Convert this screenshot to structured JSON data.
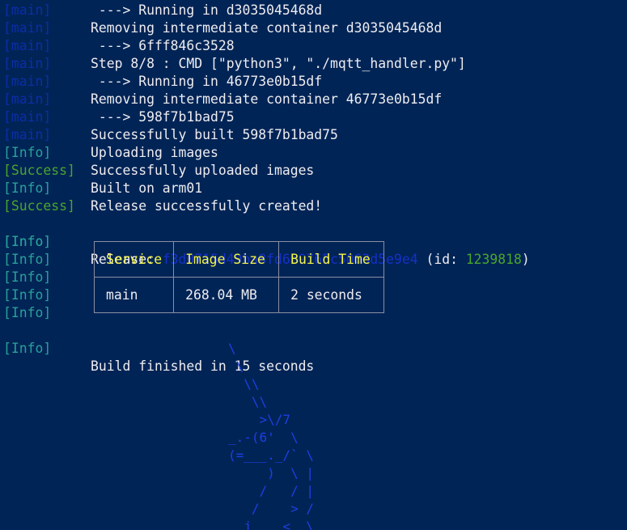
{
  "lines": [
    {
      "tag": "[main]",
      "tag_color": "main",
      "message": " ---> Running in d3035045468d"
    },
    {
      "tag": "[main]",
      "tag_color": "main",
      "message": "Removing intermediate container d3035045468d"
    },
    {
      "tag": "[main]",
      "tag_color": "main",
      "message": " ---> 6fff846c3528"
    },
    {
      "tag": "[main]",
      "tag_color": "main",
      "message": "Step 8/8 : CMD [\"python3\", \"./mqtt_handler.py\"]"
    },
    {
      "tag": "[main]",
      "tag_color": "main",
      "message": " ---> Running in 46773e0b15df"
    },
    {
      "tag": "[main]",
      "tag_color": "main",
      "message": "Removing intermediate container 46773e0b15df"
    },
    {
      "tag": "[main]",
      "tag_color": "main",
      "message": " ---> 598f7b1bad75"
    },
    {
      "tag": "[main]",
      "tag_color": "main",
      "message": "Successfully built 598f7b1bad75"
    },
    {
      "tag": "[Info]",
      "tag_color": "info",
      "message": "Uploading images"
    },
    {
      "tag": "[Success]",
      "tag_color": "success",
      "message": "Successfully uploaded images"
    },
    {
      "tag": "[Info]",
      "tag_color": "info",
      "message": "Built on arm01"
    },
    {
      "tag": "[Success]",
      "tag_color": "success",
      "message": "Release successfully created!"
    }
  ],
  "release_line": {
    "tag": "[Info]",
    "prefix": "Release: ",
    "hash": "f3d0715d49ba8fd6b9765c5063d5e9e4",
    "id_prefix": " (id: ",
    "id": "1239818",
    "id_suffix": ")"
  },
  "table_tags": [
    "[Info]",
    "[Info]",
    "[Info]",
    "[Info]",
    "[Info]"
  ],
  "table": {
    "headers": [
      "Service",
      "Image Size",
      "Build Time"
    ],
    "row": [
      "main",
      "268.04 MB",
      "2 seconds"
    ]
  },
  "final_line": {
    "tag": "[Info]",
    "message": "Build finished in 15 seconds"
  },
  "ascii_art": [
    "\\",
    " \\",
    "  \\\\",
    "   \\\\",
    "    >\\/7",
    "_.-(6'  \\",
    "(=___._/` \\",
    "     )  \\ |",
    "    /   / |",
    "   /    > /",
    "  j    < _\\"
  ],
  "colors": {
    "background": "#012456",
    "foreground": "#eeedf0",
    "main_tag": "#0a2ea8",
    "info_tag": "#2aa198",
    "success_tag": "#4aa62a",
    "table_header": "#f5f543",
    "release_hash": "#1630c8",
    "release_id": "#4aa62a",
    "ascii_art": "#1c3fe6"
  }
}
